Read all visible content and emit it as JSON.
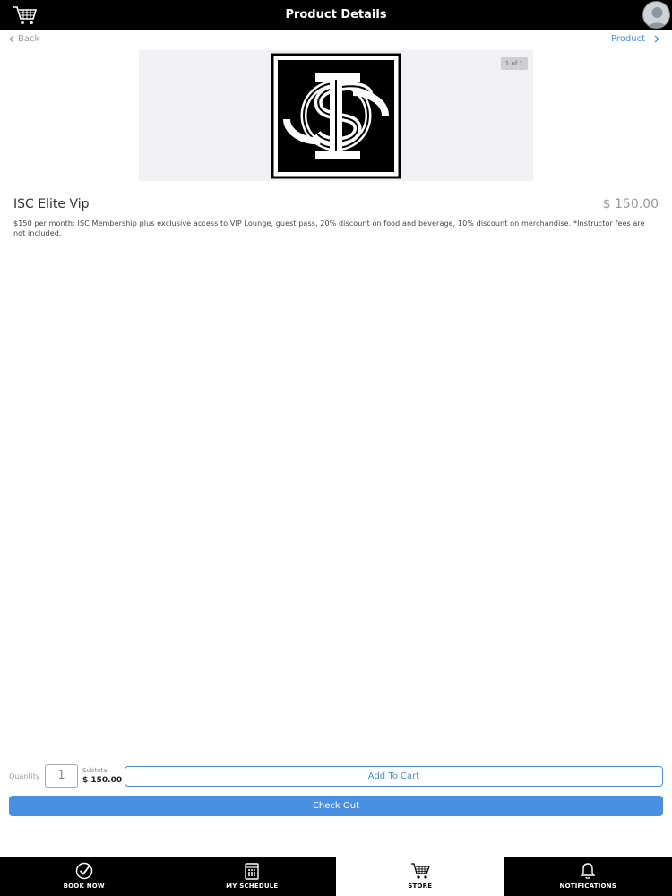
{
  "header": {
    "title": "Product Details",
    "cart_icon": "cart-icon",
    "avatar_icon": "avatar-icon"
  },
  "nav": {
    "back_label": "Back",
    "breadcrumb_label": "Product"
  },
  "product": {
    "image_counter": "1 of 1",
    "name": "ISC Elite Vip",
    "price": "$ 150.00",
    "description": "$150 per month: ISC Membership plus exclusive access to VIP Lounge, guest pass, 20% discount on food and beverage, 10% discount on merchandise. *Instructor fees are not included."
  },
  "purchase": {
    "quantity_label": "Quantity",
    "quantity_value": "1",
    "subtotal_label": "Subtotal",
    "subtotal_value": "$ 150.00",
    "add_to_cart_label": "Add To Cart",
    "checkout_label": "Check Out"
  },
  "tabs": [
    {
      "label": "BOOK NOW",
      "icon": "check-circle-icon",
      "active": false
    },
    {
      "label": "MY SCHEDULE",
      "icon": "calendar-icon",
      "active": false
    },
    {
      "label": "STORE",
      "icon": "cart-icon",
      "active": true
    },
    {
      "label": "NOTIFICATIONS",
      "icon": "bell-icon",
      "active": false
    }
  ],
  "colors": {
    "accent": "#4a90e2",
    "bar": "#000000",
    "price": "#999999"
  }
}
